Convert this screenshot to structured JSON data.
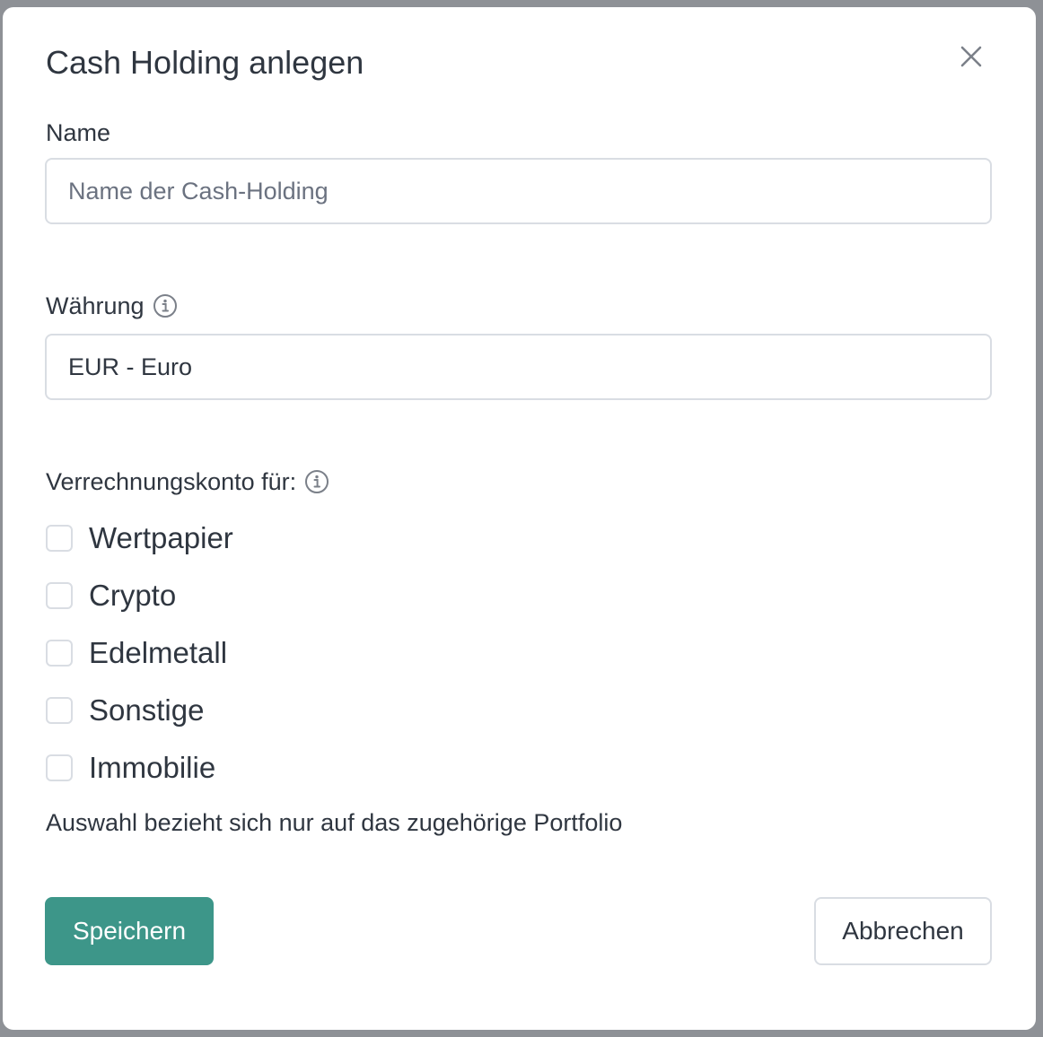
{
  "modal": {
    "title": "Cash Holding anlegen"
  },
  "name_field": {
    "label": "Name",
    "placeholder": "Name der Cash-Holding",
    "value": ""
  },
  "currency_field": {
    "label": "Währung",
    "value": "EUR - Euro",
    "info_icon": "info-icon"
  },
  "clearing_account": {
    "label": "Verrechnungskonto für:",
    "info_icon": "info-icon",
    "options": [
      {
        "label": "Wertpapier",
        "checked": false
      },
      {
        "label": "Crypto",
        "checked": false
      },
      {
        "label": "Edelmetall",
        "checked": false
      },
      {
        "label": "Sonstige",
        "checked": false
      },
      {
        "label": "Immobilie",
        "checked": false
      }
    ],
    "hint": "Auswahl bezieht sich nur auf das zugehörige Portfolio"
  },
  "actions": {
    "save_label": "Speichern",
    "cancel_label": "Abbrechen"
  },
  "colors": {
    "primary": "#3d9689",
    "text": "#2f3640",
    "border": "#d9dde3",
    "backdrop": "#8e9196"
  }
}
